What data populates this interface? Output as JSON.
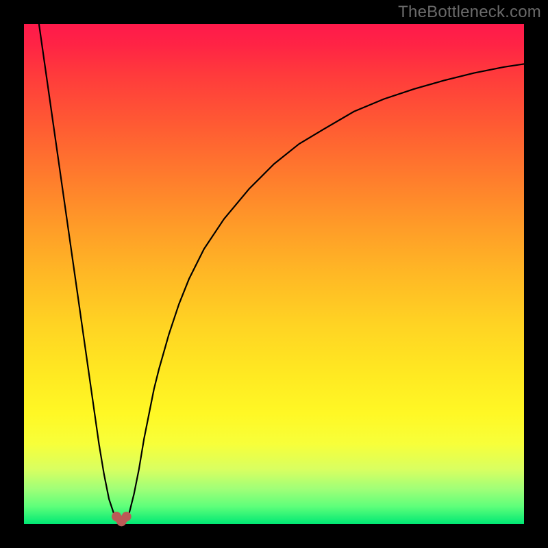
{
  "watermark": "TheBottleneck.com",
  "chart_data": {
    "type": "line",
    "title": "",
    "xlabel": "",
    "ylabel": "",
    "xlim": [
      0,
      100
    ],
    "ylim": [
      0,
      100
    ],
    "grid": false,
    "series": [
      {
        "name": "bottleneck-curve",
        "x": [
          3,
          4,
          5,
          6,
          7,
          8,
          9,
          10,
          11,
          12,
          13,
          14,
          15,
          16,
          17,
          18,
          19,
          20,
          21,
          22,
          23,
          24,
          25,
          26,
          27,
          29,
          31,
          33,
          36,
          40,
          45,
          50,
          55,
          60,
          66,
          72,
          78,
          84,
          90,
          96,
          100
        ],
        "values": [
          100,
          93,
          86,
          79,
          72,
          65,
          58,
          51,
          44,
          37,
          30,
          23,
          16,
          10,
          5,
          2,
          0.5,
          0.5,
          2,
          6,
          11,
          17,
          22,
          27,
          31,
          38,
          44,
          49,
          55,
          61,
          67,
          72,
          76,
          79,
          82.5,
          85,
          87,
          88.7,
          90.2,
          91.4,
          92
        ]
      }
    ],
    "markers": [
      {
        "name": "min-marker-left",
        "x": 18.5,
        "y": 1.5
      },
      {
        "name": "min-marker-mid",
        "x": 19.5,
        "y": 0.5
      },
      {
        "name": "min-marker-right",
        "x": 20.5,
        "y": 1.5
      }
    ],
    "colors": {
      "curve": "#000000",
      "marker": "#bb5a56",
      "gradient_top": "#ff1a4b",
      "gradient_bottom": "#00e874"
    }
  }
}
